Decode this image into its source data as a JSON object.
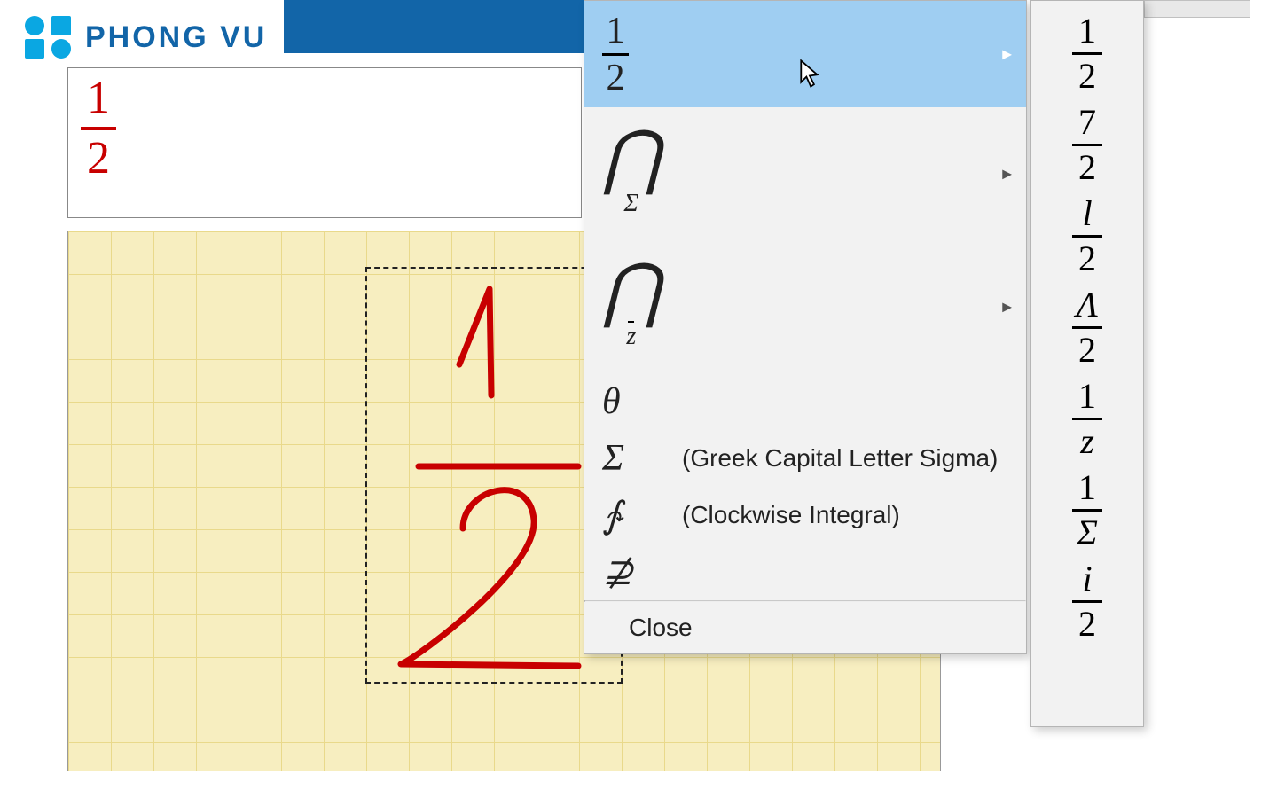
{
  "logo": {
    "text": "PHONG VU"
  },
  "preview": {
    "numerator": "1",
    "denominator": "2"
  },
  "menu": {
    "items": [
      {
        "kind": "fraction",
        "numerator": "1",
        "denominator": "2",
        "has_submenu": true,
        "selected": true
      },
      {
        "kind": "bigop",
        "op": "⋂",
        "sub": "Σ",
        "has_submenu": true
      },
      {
        "kind": "bigop",
        "op": "⋂",
        "sub": "z",
        "overline_sub": true,
        "has_submenu": true
      },
      {
        "kind": "symbol",
        "sym": "θ",
        "label": ""
      },
      {
        "kind": "symbol",
        "sym": "Σ",
        "label": "(Greek Capital Letter Sigma)"
      },
      {
        "kind": "symbol",
        "sym": "∱",
        "label": "(Clockwise Integral)"
      },
      {
        "kind": "symbol",
        "sym": "⊉",
        "label": ""
      }
    ],
    "close": "Close"
  },
  "submenu": {
    "items": [
      {
        "n": "1",
        "d": "2"
      },
      {
        "n": "7",
        "d": "2"
      },
      {
        "n": "l",
        "d": "2",
        "n_italic": true
      },
      {
        "n": "Λ",
        "d": "2",
        "n_italic": true
      },
      {
        "n": "1",
        "d": "z",
        "d_italic": true
      },
      {
        "n": "1",
        "d": "Σ",
        "d_italic": true
      },
      {
        "n": "i",
        "d": "2",
        "n_italic": true
      }
    ]
  }
}
